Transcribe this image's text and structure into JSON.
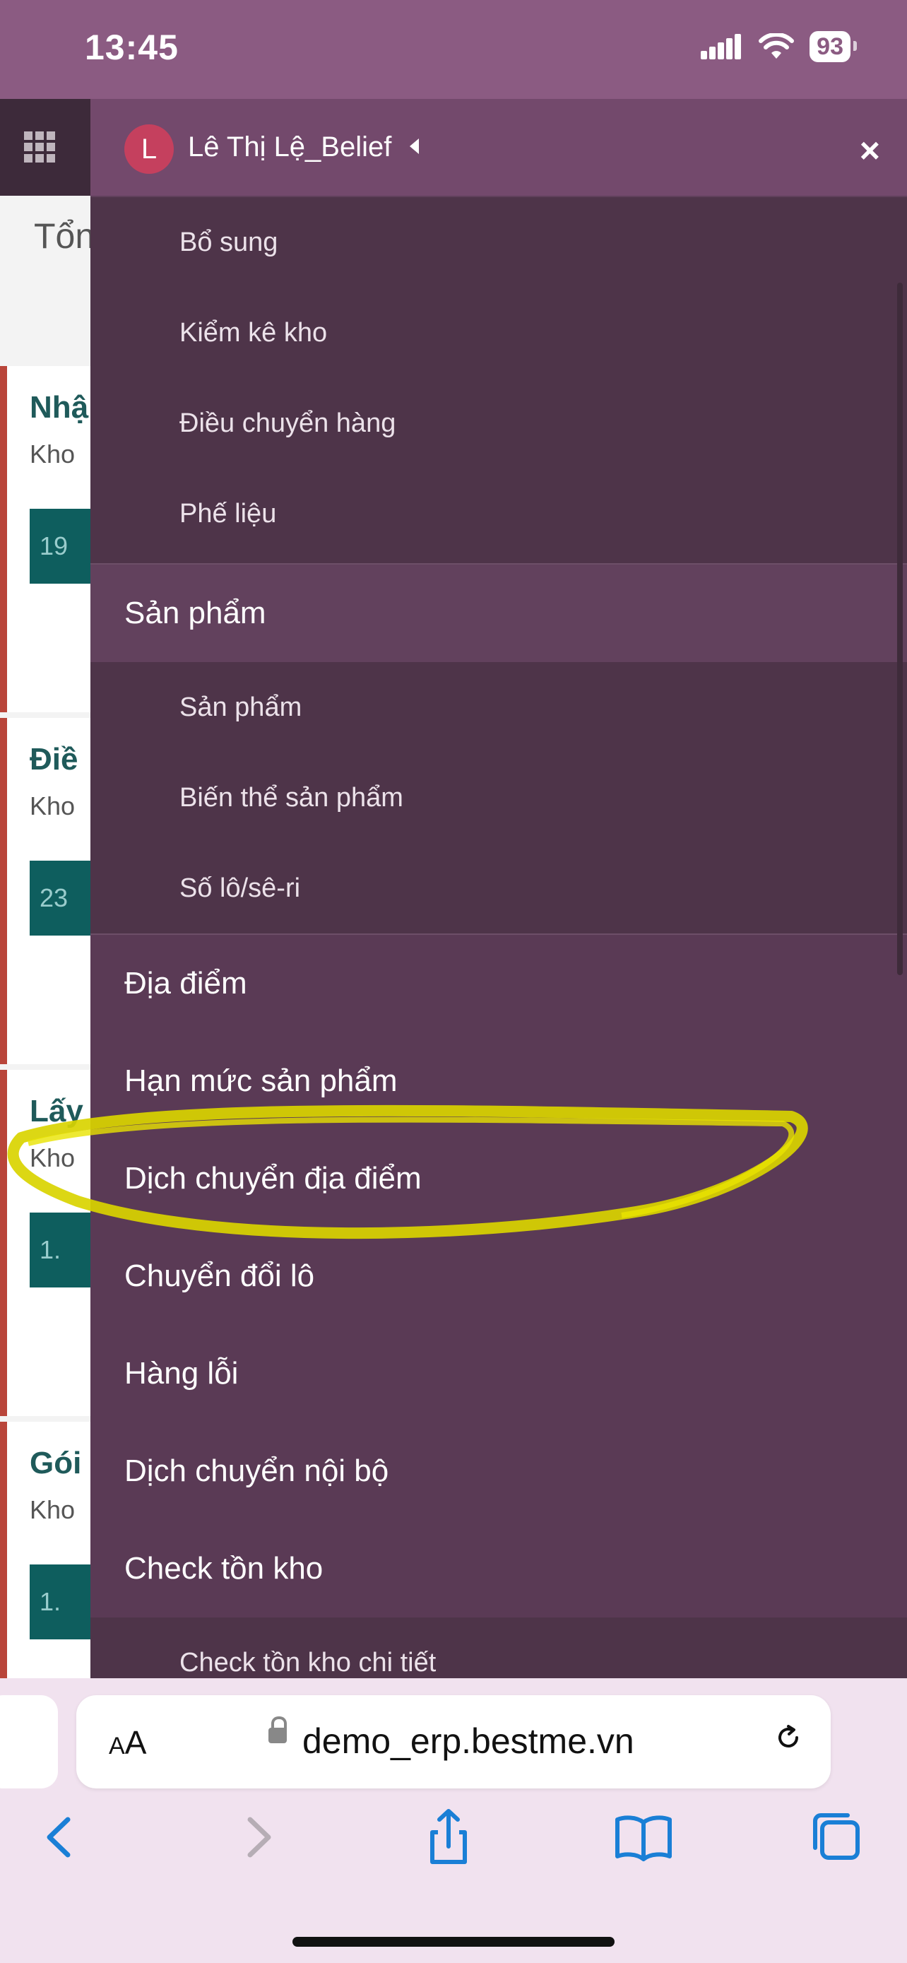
{
  "status_bar": {
    "time": "13:45",
    "battery": "93"
  },
  "background_page": {
    "title": "Tổn",
    "cards": [
      {
        "title": "Nhậ",
        "subtitle": "Kho",
        "button": "19"
      },
      {
        "title": "Điề",
        "subtitle": "Kho",
        "button": "23"
      },
      {
        "title": "Lấy",
        "subtitle": "Kho",
        "button": "1."
      },
      {
        "title": "Gói",
        "subtitle": "Kho",
        "button": "1."
      }
    ]
  },
  "drawer": {
    "user": {
      "avatar_letter": "L",
      "name": "Lê Thị Lệ_Belief"
    },
    "close_icon": "×",
    "menu": [
      {
        "label": "Bổ sung",
        "level": "sub"
      },
      {
        "label": "Kiểm kê kho",
        "level": "sub"
      },
      {
        "label": "Điều chuyển hàng",
        "level": "sub"
      },
      {
        "label": "Phế liệu",
        "level": "sub"
      },
      {
        "label": "Sản phẩm",
        "level": "section"
      },
      {
        "label": "Sản phẩm",
        "level": "sub"
      },
      {
        "label": "Biến thể sản phẩm",
        "level": "sub"
      },
      {
        "label": "Số lô/sê-ri",
        "level": "sub"
      },
      {
        "label": "Địa điểm",
        "level": "main"
      },
      {
        "label": "Hạn mức sản phẩm",
        "level": "main"
      },
      {
        "label": "Dịch chuyển địa điểm",
        "level": "main",
        "highlighted": true
      },
      {
        "label": "Chuyển đổi lô",
        "level": "main"
      },
      {
        "label": "Hàng lỗi",
        "level": "main"
      },
      {
        "label": "Dịch chuyển nội bộ",
        "level": "main"
      },
      {
        "label": "Check tồn kho",
        "level": "main"
      },
      {
        "label": "Check tồn kho chi tiết",
        "level": "sub"
      }
    ],
    "highlight_color": "#e2e000"
  },
  "safari": {
    "text_size_label_small": "A",
    "text_size_label_large": "A",
    "url": "demo_erp.bestme.vn"
  },
  "colors": {
    "drawer_bg": "#5a3a55",
    "header_bg": "#73496c",
    "accent_link": "#1a7fd6"
  }
}
